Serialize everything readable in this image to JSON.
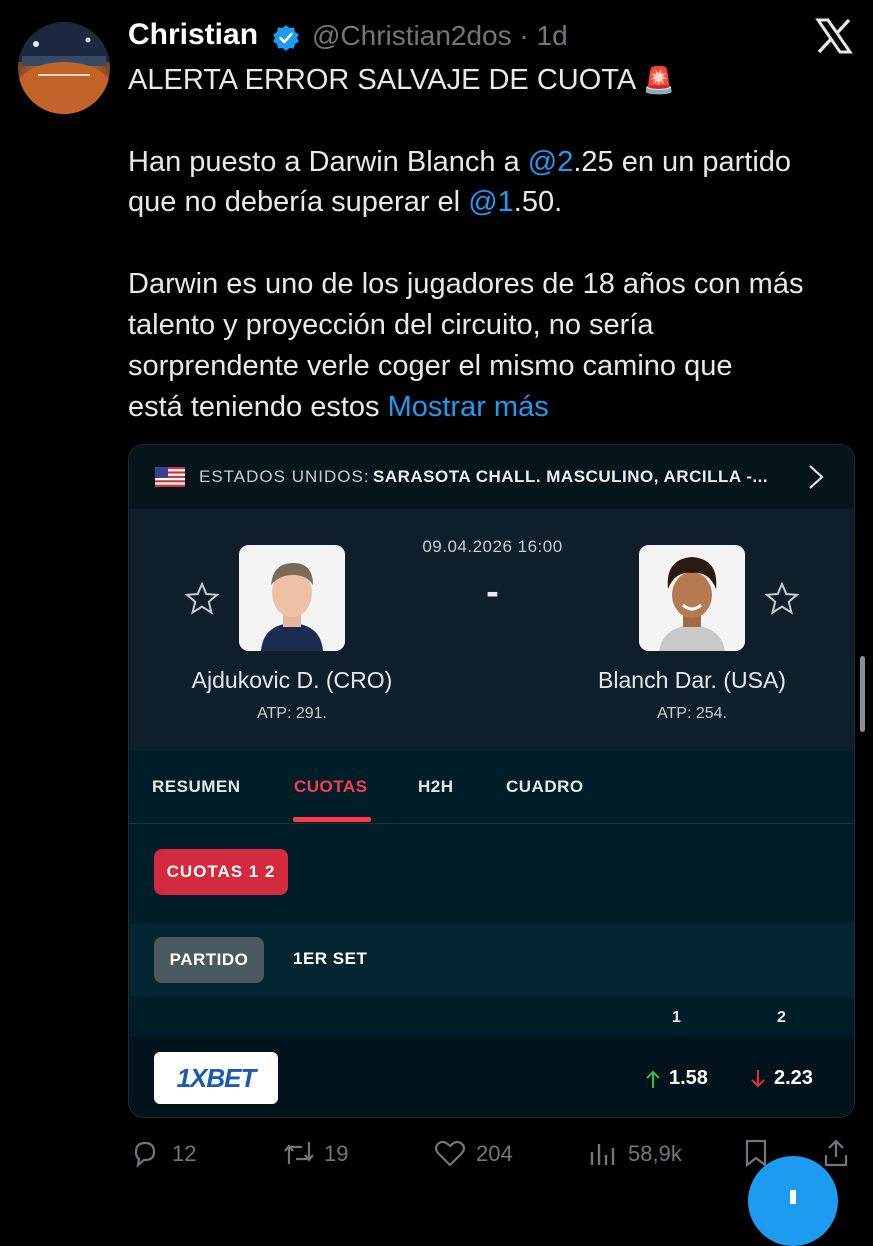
{
  "tweet": {
    "author_name": "Christian",
    "handle": "@Christian2dos",
    "time": "· 1d",
    "headline": "ALERTA ERROR SALVAJE DE CUOTA",
    "headline_emoji": "🚨",
    "p1_line1_pre": "Han puesto a Darwin Blanch a ",
    "p1_mention1": "@2",
    "p1_line1_post": ".25 en un partido",
    "p1_line2_pre": "que no debería superar el ",
    "p1_mention2": "@1",
    "p1_line2_post": ".50.",
    "p2_line1": "Darwin es uno de los jugadores de 18 años con más",
    "p2_line2": "talento y proyección del circuito, no sería",
    "p2_line3": "sorprendente verle coger el mismo camino que",
    "p2_line4": "está teniendo estos ",
    "show_more": "Mostrar más"
  },
  "card": {
    "country": "ESTADOS UNIDOS:",
    "tournament": "SARASOTA CHALL. MASCULINO, ARCILLA -...",
    "datetime": "09.04.2026 16:00",
    "score": "-",
    "player1": {
      "name": "Ajdukovic D. (CRO)",
      "rank": "ATP: 291."
    },
    "player2": {
      "name": "Blanch Dar. (USA)",
      "rank": "ATP: 254."
    },
    "tabs": [
      "RESUMEN",
      "CUOTAS",
      "H2H",
      "CUADRO"
    ],
    "active_tab": "CUOTAS",
    "odds_button": "CUOTAS 1 2",
    "periods": [
      "PARTIDO",
      "1ER SET"
    ],
    "col_headers": [
      "1",
      "2"
    ],
    "bookmaker": "1XBET",
    "odd1": "1.58",
    "odd1_trend": "up",
    "odd2": "2.23",
    "odd2_trend": "down",
    "colors": {
      "accent": "#ff3a4d",
      "odds_button": "#d32a3e",
      "up": "#2fbf4f",
      "down": "#e0303c"
    }
  },
  "actions": {
    "replies": "12",
    "reposts": "19",
    "likes": "204",
    "views": "58,9k"
  },
  "icons": [
    "verified-badge-icon",
    "x-logo-icon",
    "star-icon",
    "chevron-right-icon",
    "reply-icon",
    "repost-icon",
    "like-icon",
    "views-icon",
    "bookmark-icon",
    "share-icon"
  ]
}
